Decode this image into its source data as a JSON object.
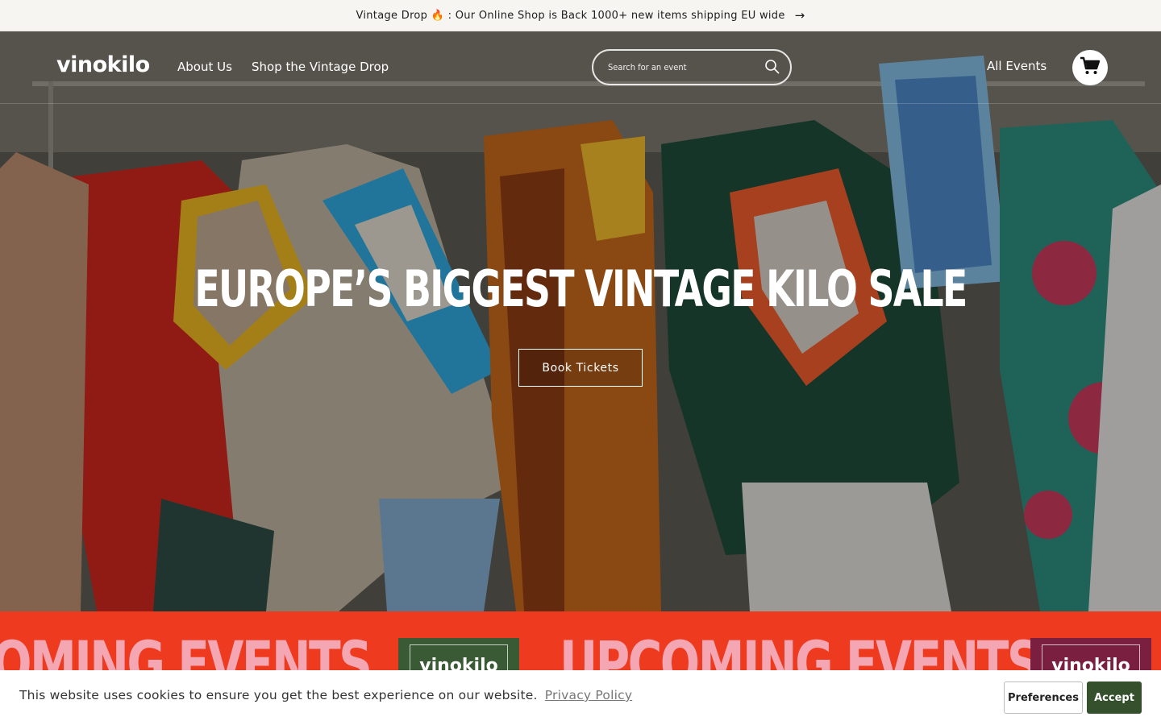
{
  "announcement": {
    "text": "Vintage Drop 🔥 : Our Online Shop is Back 1000+ new items shipping EU wide",
    "arrow_icon": "arrow-right-icon"
  },
  "header": {
    "logo": "vinokilo",
    "nav": [
      {
        "label": "About Us"
      },
      {
        "label": "Shop the Vintage Drop"
      }
    ],
    "search": {
      "placeholder": "Search for an event",
      "icon": "search-icon"
    },
    "all_events": "All Events",
    "cart_icon": "cart-icon"
  },
  "hero": {
    "headline": "EUROPE’S BIGGEST VINTAGE KILO SALE",
    "cta": "Book Tickets"
  },
  "marquee": {
    "items": [
      {
        "text": "COMING EVENTS"
      },
      {
        "text": "UPCOMING EVENTS"
      }
    ],
    "card_logo": "vinokilo",
    "colors": {
      "background": "#ee3b1f",
      "text": "#f4a6b3",
      "card1": "#3a5a35",
      "card2": "#7a1f3f"
    }
  },
  "cookie": {
    "text": "This website uses cookies to ensure you get the best experience on our website.",
    "link": "Privacy Policy",
    "preferences": "Preferences",
    "accept": "Accept"
  },
  "colors": {
    "accept_button": "#34502c"
  }
}
